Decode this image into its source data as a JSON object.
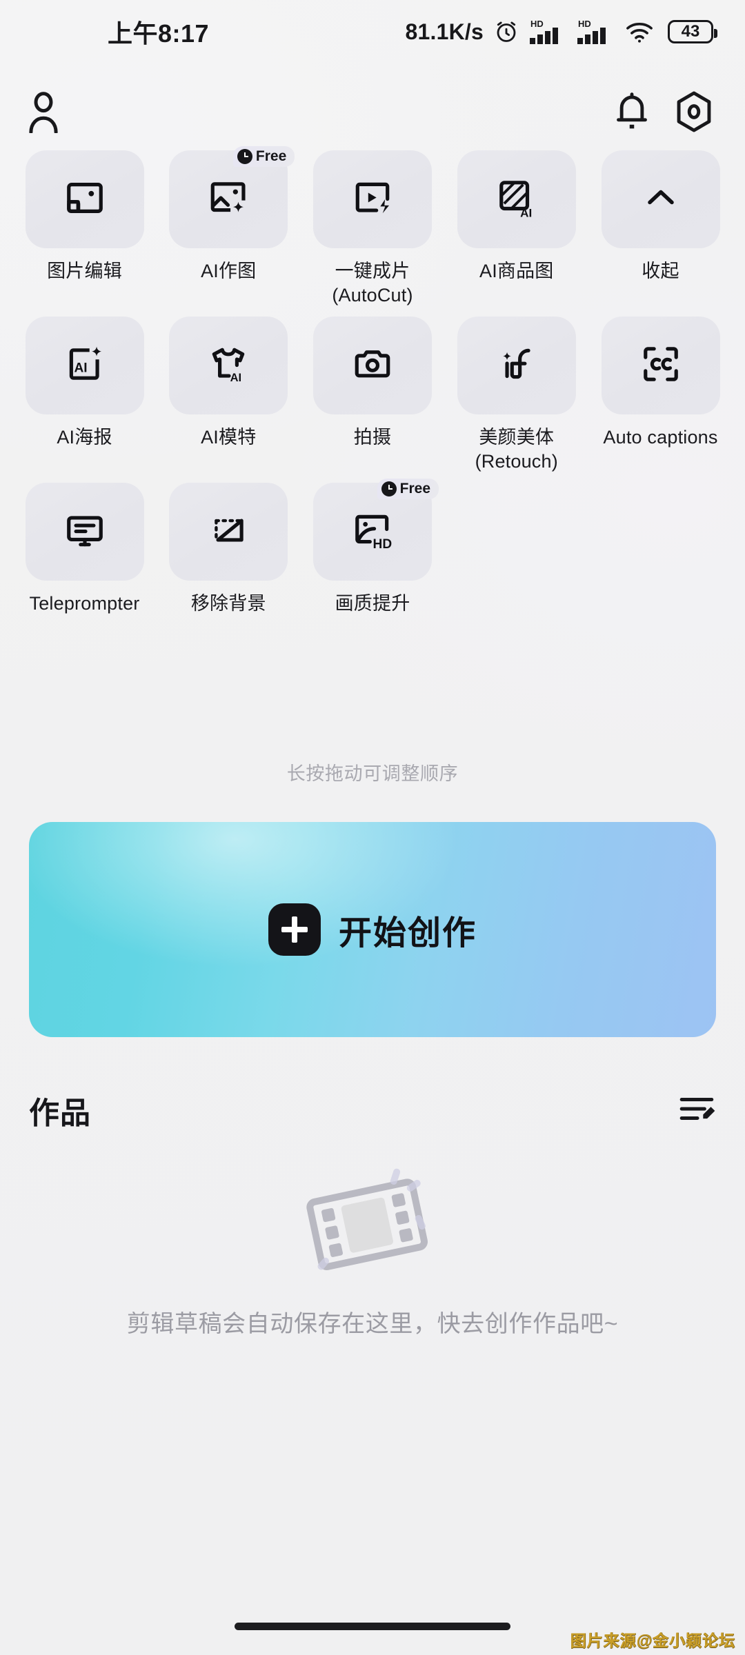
{
  "status_bar": {
    "time": "上午8:17",
    "network_speed": "81.1K/s",
    "alarm_icon": "alarm-clock-icon",
    "signal1_label": "HD",
    "signal2_label": "HD",
    "wifi_icon": "wifi-icon",
    "battery_level": "43"
  },
  "top_nav": {
    "profile_icon": "profile-icon",
    "notification_icon": "bell-icon",
    "settings_icon": "settings-gear-icon"
  },
  "tools": {
    "hint": "长按拖动可调整顺序",
    "rows": [
      [
        {
          "label": "图片编辑",
          "icon": "image-edit-icon",
          "badge": null
        },
        {
          "label": "AI作图",
          "icon": "ai-image-sparkle-icon",
          "badge": "Free"
        },
        {
          "label": "一键成片\n(AutoCut)",
          "icon": "autocut-video-icon",
          "badge": null
        },
        {
          "label": "AI商品图",
          "icon": "ai-product-image-icon",
          "badge": null
        },
        {
          "label": "收起",
          "icon": "chevron-up-icon",
          "badge": null
        }
      ],
      [
        {
          "label": "AI海报",
          "icon": "ai-poster-icon",
          "badge": null
        },
        {
          "label": "AI模特",
          "icon": "ai-model-shirt-icon",
          "badge": null
        },
        {
          "label": "拍摄",
          "icon": "camera-icon",
          "badge": null
        },
        {
          "label": "美颜美体\n(Retouch)",
          "icon": "retouch-face-icon",
          "badge": null
        },
        {
          "label": "Auto captions",
          "icon": "closed-captions-icon",
          "badge": null
        }
      ],
      [
        {
          "label": "Teleprompter",
          "icon": "teleprompter-monitor-icon",
          "badge": null
        },
        {
          "label": "移除背景",
          "icon": "remove-background-icon",
          "badge": null
        },
        {
          "label": "画质提升",
          "icon": "hd-enhance-icon",
          "badge": "Free"
        }
      ]
    ]
  },
  "create_button": {
    "label": "开始创作",
    "plus_icon": "plus-icon",
    "gradient_from": "#5ed4e0",
    "gradient_to": "#9dc3f3"
  },
  "works": {
    "title": "作品",
    "manage_icon": "edit-list-icon",
    "empty_illustration": "film-strip-icon",
    "empty_text": "剪辑草稿会自动保存在这里，快去创作作品吧~"
  },
  "footer": {
    "home_indicator": "home-indicator",
    "watermark": "图片来源@金小颖论坛"
  }
}
